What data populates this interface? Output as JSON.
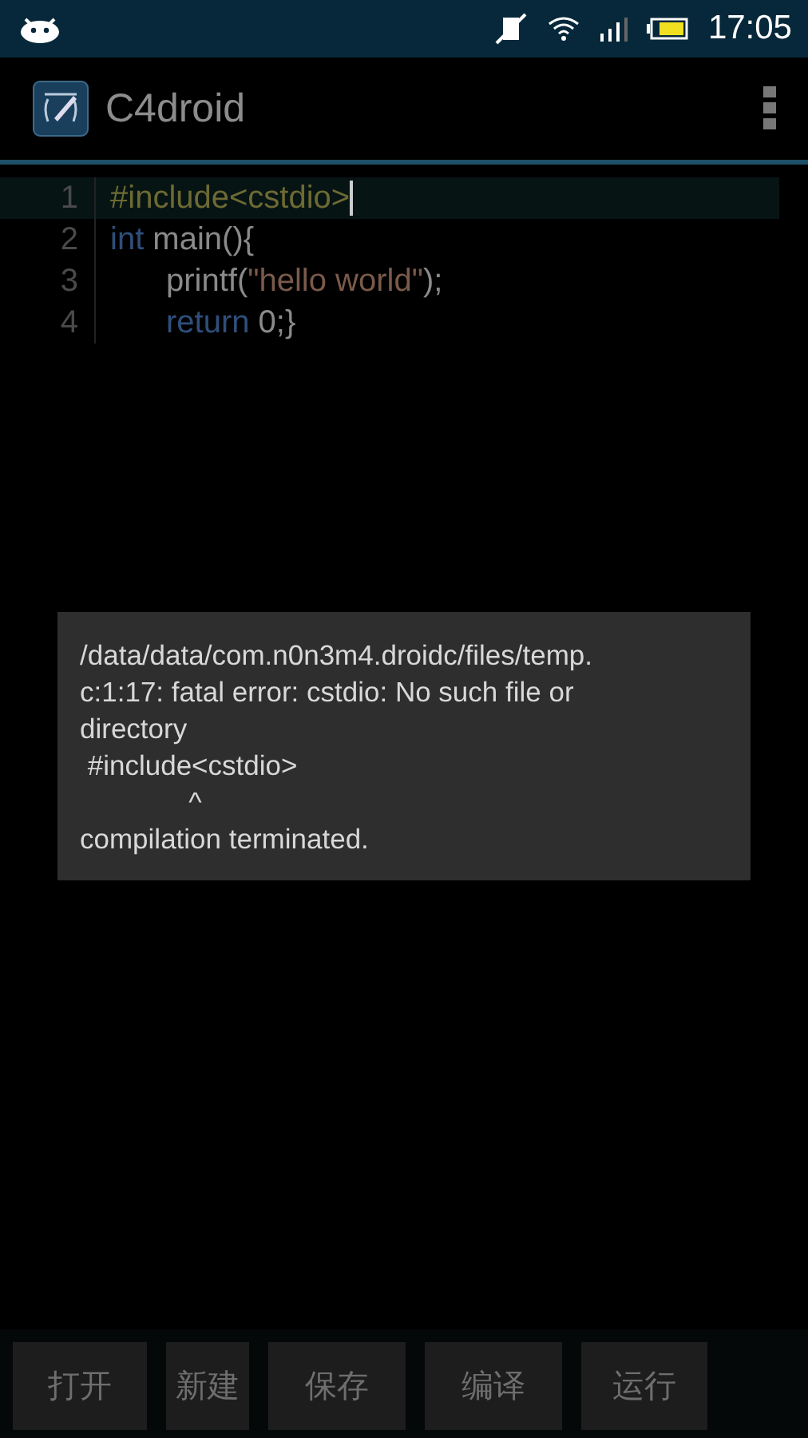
{
  "status_bar": {
    "time": "17:05"
  },
  "action_bar": {
    "title": "C4droid"
  },
  "editor": {
    "lines": [
      {
        "number": "1",
        "current": true,
        "indented": false,
        "tokens": [
          {
            "kind": "preprocessor",
            "text": "#include<cstdio>"
          }
        ]
      },
      {
        "number": "2",
        "current": false,
        "indented": false,
        "tokens": [
          {
            "kind": "keyword",
            "text": "int"
          },
          {
            "kind": "plain",
            "text": " main(){"
          }
        ]
      },
      {
        "number": "3",
        "current": false,
        "indented": true,
        "tokens": [
          {
            "kind": "plain",
            "text": "printf("
          },
          {
            "kind": "string",
            "text": "\"hello world\""
          },
          {
            "kind": "plain",
            "text": ");"
          }
        ]
      },
      {
        "number": "4",
        "current": false,
        "indented": true,
        "tokens": [
          {
            "kind": "keyword",
            "text": "return"
          },
          {
            "kind": "plain",
            "text": " 0;}"
          }
        ]
      }
    ]
  },
  "toast": {
    "lines": [
      "/data/data/com.n0n3m4.droidc/files/temp.",
      "c:1:17: fatal error: cstdio: No such file or",
      "directory",
      " #include<cstdio>",
      "              ^",
      "compilation terminated."
    ]
  },
  "buttons": [
    "打开",
    "新建",
    "保存",
    "编译",
    "运行"
  ]
}
